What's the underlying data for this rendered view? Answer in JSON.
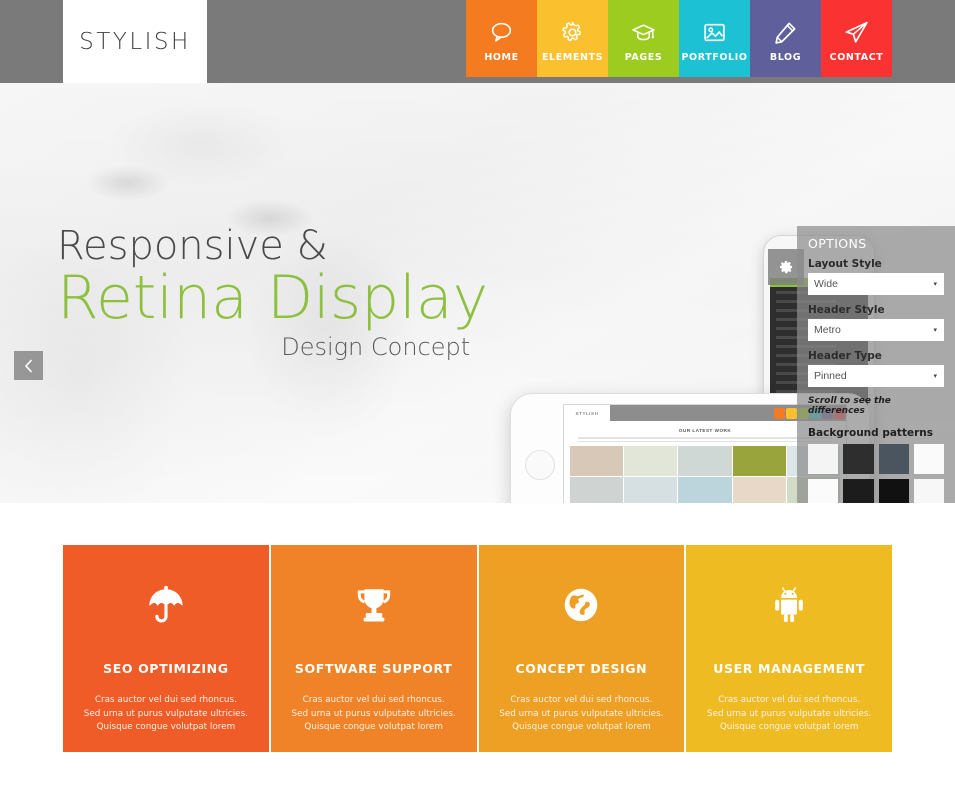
{
  "header": {
    "logo": "STYLISH",
    "nav": [
      {
        "label": "HOME",
        "icon": "speech-bubble-icon",
        "color": "#f47b20"
      },
      {
        "label": "ELEMENTS",
        "icon": "gear-icon",
        "color": "#fbc02d"
      },
      {
        "label": "PAGES",
        "icon": "graduation-cap-icon",
        "color": "#9ccc1f"
      },
      {
        "label": "PORTFOLIO",
        "icon": "image-icon",
        "color": "#1cc2d4"
      },
      {
        "label": "BLOG",
        "icon": "pencil-icon",
        "color": "#5f5f9c"
      },
      {
        "label": "CONTACT",
        "icon": "paper-plane-icon",
        "color": "#fa3232"
      }
    ],
    "bar_color": "#7a7a7a"
  },
  "hero": {
    "line1": "Responsive &",
    "line2": "Retina Display",
    "line3": "Design Concept",
    "accent_color": "#8dc03f",
    "prev_label": "‹",
    "phone_front": {
      "logo": "STYLISH",
      "heading": "OUR LATEST WORK"
    }
  },
  "options": {
    "title": "OPTIONS",
    "fields": [
      {
        "label": "Layout Style",
        "value": "Wide",
        "caret": "▾"
      },
      {
        "label": "Header Style",
        "value": "Metro",
        "caret": "▾"
      },
      {
        "label": "Header Type",
        "value": "Pinned",
        "caret": "▾"
      }
    ],
    "note": "Scroll to see the differences",
    "patterns_label": "Background patterns",
    "patterns": [
      "#f4f4f4",
      "#2e2e2e",
      "#4a5560",
      "#fafafa",
      "#fbfbfb",
      "#1c1c1c",
      "#111111",
      "#f7f7f7",
      "#f0b55e",
      "#3a3a3a",
      "#f8dfbb",
      "#fdfdfd",
      "#e9e9e9",
      "#fcfcfc",
      "#232323",
      "#fbfbfb"
    ],
    "gear_icon": "gear-icon"
  },
  "features": [
    {
      "title": "SEO OPTIMIZING",
      "icon": "umbrella-icon",
      "color": "#ef5c27",
      "desc_lines": [
        "Cras auctor vel dui sed rhoncus.",
        "Sed urna ut purus vulputate ultricies.",
        "Quisque congue volutpat lorem"
      ]
    },
    {
      "title": "SOFTWARE SUPPORT",
      "icon": "trophy-icon",
      "color": "#f08327",
      "desc_lines": [
        "Cras auctor vel dui sed rhoncus.",
        "Sed urna ut purus vulputate ultricies.",
        "Quisque congue volutpat lorem"
      ]
    },
    {
      "title": "CONCEPT DESIGN",
      "icon": "globe-icon",
      "color": "#eda023",
      "desc_lines": [
        "Cras auctor vel dui sed rhoncus.",
        "Sed urna ut purus vulputate ultricies.",
        "Quisque congue volutpat lorem"
      ]
    },
    {
      "title": "USER MANAGEMENT",
      "icon": "android-icon",
      "color": "#eebb22",
      "desc_lines": [
        "Cras auctor vel dui sed rhoncus.",
        "Sed urna ut purus vulputate ultricies.",
        "Quisque congue volutpat lorem"
      ]
    }
  ]
}
